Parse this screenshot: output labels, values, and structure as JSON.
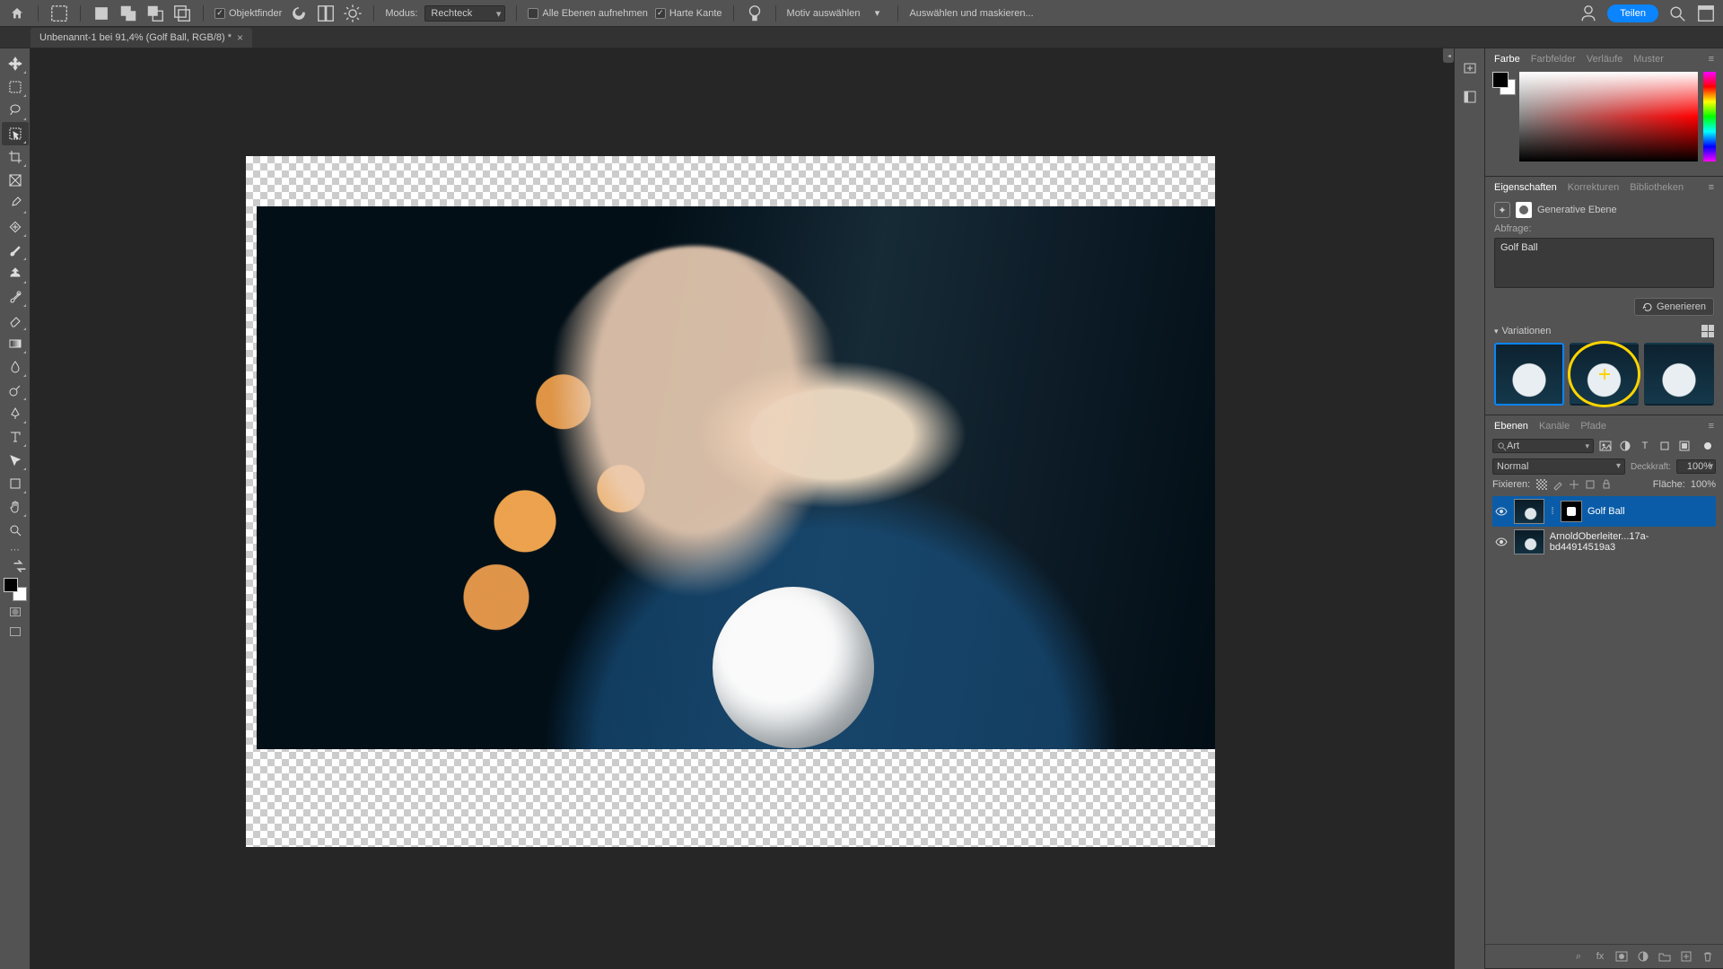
{
  "menubar": {
    "mode_label": "Modus:",
    "mode_value": "Rechteck",
    "objektfinder": "Objektfinder",
    "alle_ebenen": "Alle Ebenen aufnehmen",
    "harte_kante": "Harte Kante",
    "motiv": "Motiv auswählen",
    "maskieren": "Auswählen und maskieren...",
    "share": "Teilen"
  },
  "tab": {
    "title": "Unbenannt-1 bei 91,4% (Golf Ball, RGB/8) *"
  },
  "color_panel": {
    "tabs": [
      "Farbe",
      "Farbfelder",
      "Verläufe",
      "Muster"
    ],
    "active": 0
  },
  "props_panel": {
    "tabs": [
      "Eigenschaften",
      "Korrekturen",
      "Bibliotheken"
    ],
    "active": 0,
    "layer_type": "Generative Ebene",
    "prompt_label": "Abfrage:",
    "prompt_value": "Golf Ball",
    "generate": "Generieren",
    "variations_label": "Variationen"
  },
  "layers_panel": {
    "tabs": [
      "Ebenen",
      "Kanäle",
      "Pfade"
    ],
    "active": 0,
    "filter_label": "Art",
    "blend_mode": "Normal",
    "opacity_label": "Deckkraft:",
    "opacity_value": "100%",
    "lock_label": "Fixieren:",
    "fill_label": "Fläche:",
    "fill_value": "100%",
    "layers": [
      {
        "name": "Golf Ball",
        "selected": true,
        "has_mask": true
      },
      {
        "name": "ArnoldOberleiter...17a-bd44914519a3",
        "selected": false,
        "has_mask": false
      }
    ]
  }
}
